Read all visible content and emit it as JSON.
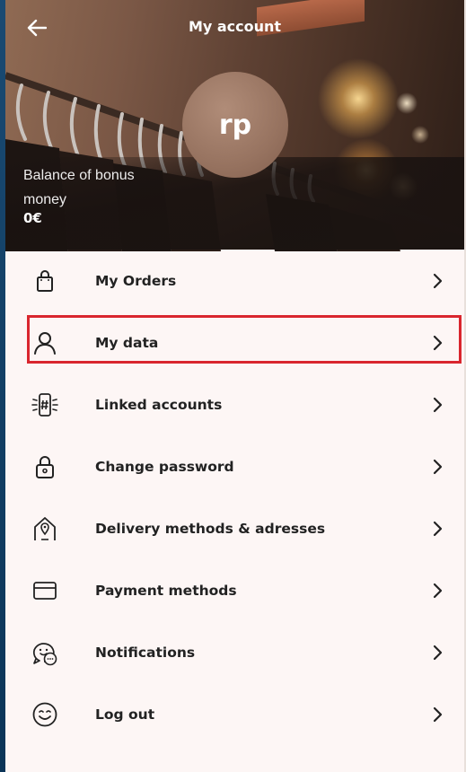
{
  "header": {
    "title": "My account",
    "back_icon": "arrow-left-icon"
  },
  "profile": {
    "avatar_initials": "rp",
    "balance_label": "Balance of bonus money",
    "balance_value": "0€"
  },
  "menu": {
    "items": [
      {
        "label": "My Orders",
        "icon": "shopping-bag-icon"
      },
      {
        "label": "My data",
        "icon": "user-icon",
        "highlighted": true
      },
      {
        "label": "Linked accounts",
        "icon": "phone-hashtag-icon"
      },
      {
        "label": "Change password",
        "icon": "lock-icon"
      },
      {
        "label": "Delivery methods & adresses",
        "icon": "home-location-icon"
      },
      {
        "label": "Payment methods",
        "icon": "credit-card-icon"
      },
      {
        "label": "Notifications",
        "icon": "chat-bubbles-icon"
      },
      {
        "label": "Log out",
        "icon": "smiley-face-icon"
      }
    ],
    "chevron_icon": "chevron-right-icon"
  },
  "colors": {
    "background": "#fdf6f5",
    "text": "#222222",
    "highlight_border": "#d9262e"
  }
}
